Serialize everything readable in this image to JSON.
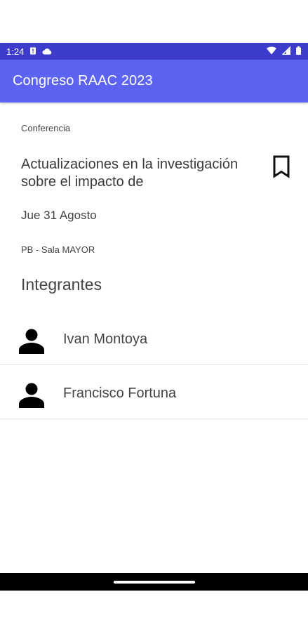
{
  "status_bar": {
    "time": "1:24",
    "icons": [
      "sim-alert-icon",
      "cloud-icon",
      "wifi-icon",
      "signal-icon",
      "battery-icon"
    ]
  },
  "app_bar": {
    "title": "Congreso RAAC 2023"
  },
  "event": {
    "category": "Conferencia",
    "title": "Actualizaciones en la investigación sobre el impacto de",
    "date": "Jue 31 Agosto",
    "room": "PB - Sala MAYOR",
    "bookmark_icon": "bookmark-outline-icon"
  },
  "members_section": {
    "title": "Integrantes",
    "members": [
      {
        "name": "Ivan Montoya",
        "icon": "person-icon"
      },
      {
        "name": "Francisco Fortuna",
        "icon": "person-icon"
      }
    ]
  },
  "colors": {
    "status_bar": "#3d3ccc",
    "app_bar": "#5b63f0",
    "nav_bar": "#000000"
  }
}
